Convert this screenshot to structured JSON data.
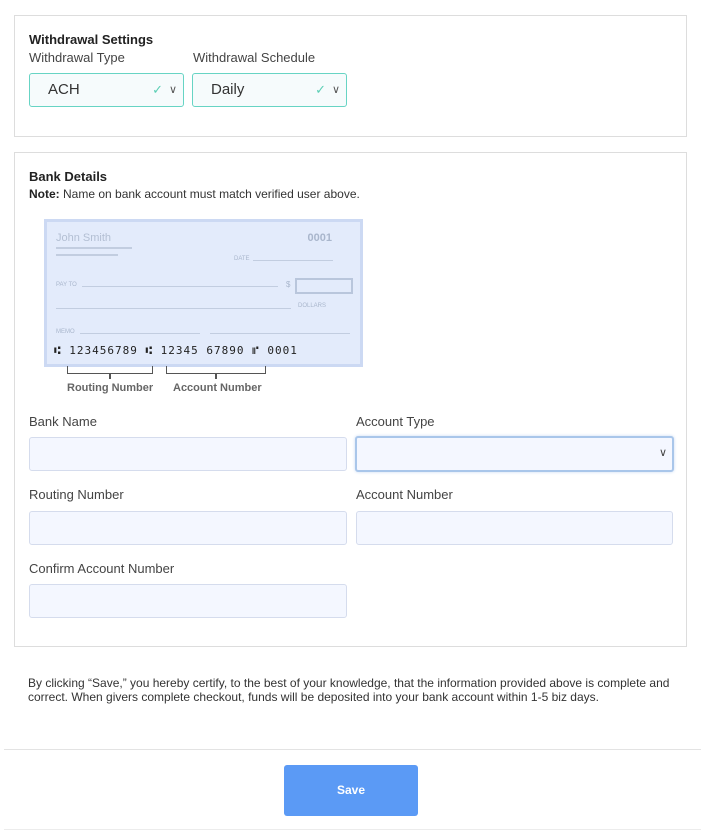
{
  "withdrawal_settings": {
    "title": "Withdrawal Settings",
    "type_label": "Withdrawal Type",
    "type_value": "ACH",
    "schedule_label": "Withdrawal Schedule",
    "schedule_value": "Daily"
  },
  "bank_details": {
    "title": "Bank Details",
    "note_prefix": "Note:",
    "note_text": " Name on bank account must match verified user above.",
    "check": {
      "name": "John Smith",
      "number": "0001",
      "date_label": "DATE",
      "pay_to_label": "PAY TO",
      "dollar_sign": "$",
      "dollars_label": "DOLLARS",
      "memo_label": "MEMO",
      "micr": "⑆ 123456789 ⑆ 12345 67890 ⑈ 0001",
      "routing_caption": "Routing Number",
      "account_caption": "Account Number"
    },
    "fields": {
      "bank_name_label": "Bank Name",
      "account_type_label": "Account Type",
      "routing_number_label": "Routing Number",
      "account_number_label": "Account Number",
      "confirm_account_label": "Confirm Account Number"
    }
  },
  "disclaimer": "By clicking “Save,” you hereby certify, to the best of your knowledge, that the information provided above is complete and correct. When givers complete checkout, funds will be deposited into your bank account within 1-5 biz days.",
  "save_label": "Save",
  "colors": {
    "accent": "#5b9af5",
    "valid": "#5ccfb5",
    "input_bg": "#f4f7ff"
  }
}
